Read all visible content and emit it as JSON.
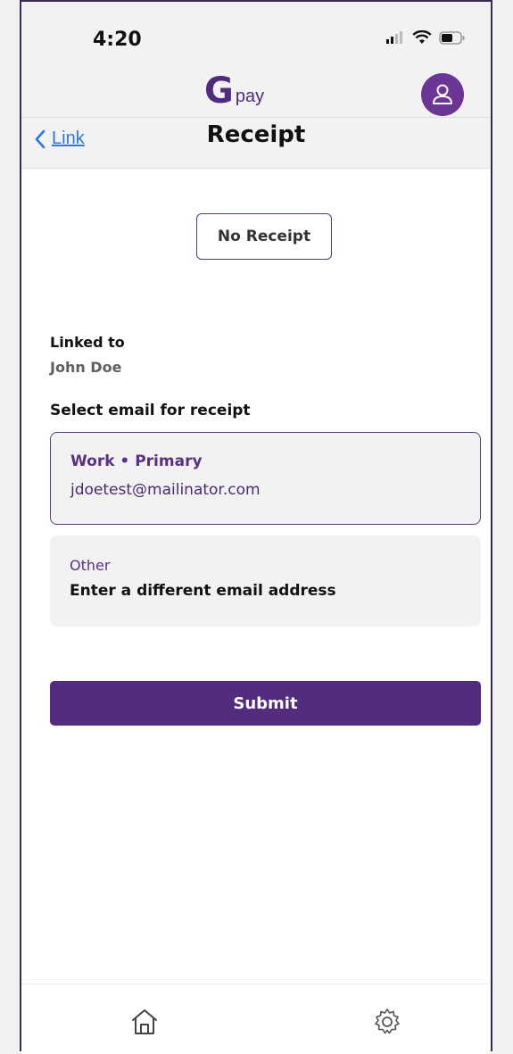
{
  "status_bar": {
    "time": "4:20"
  },
  "header": {
    "logo_mark": "G",
    "logo_text": "pay",
    "back_label": "Link",
    "title": "Receipt"
  },
  "main": {
    "no_receipt_label": "No Receipt",
    "linked_label": "Linked to",
    "linked_name": "John Doe",
    "select_label": "Select email for receipt",
    "email_options": [
      {
        "title": "Work • Primary",
        "email": "jdoetest@mailinator.com",
        "selected": true
      },
      {
        "title": "Other",
        "text": "Enter a different email address",
        "selected": false
      }
    ],
    "submit_label": "Submit"
  },
  "tab_bar": {
    "items": [
      {
        "icon": "home-icon"
      },
      {
        "icon": "gear-icon"
      }
    ]
  },
  "colors": {
    "brand": "#532b7f",
    "link": "#2a79e3",
    "background": "#f2f2f3"
  }
}
